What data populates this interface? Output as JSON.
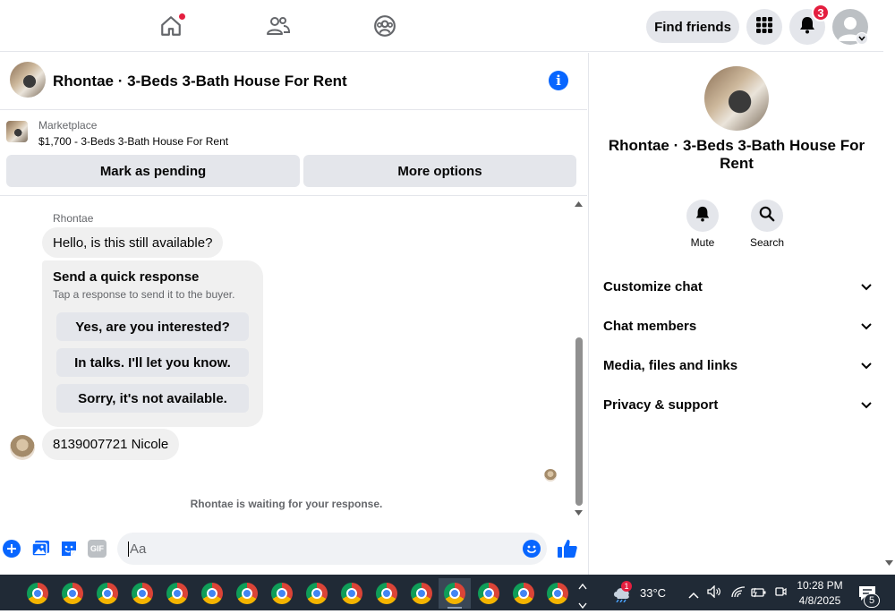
{
  "topnav": {
    "find_friends_label": "Find friends",
    "notification_count": "3"
  },
  "chat": {
    "title": "Rhontae · 3-Beds 3-Bath House For Rent",
    "marketplace_label": "Marketplace",
    "listing": "$1,700 - 3-Beds 3-Bath House For Rent",
    "mark_pending_label": "Mark as pending",
    "more_options_label": "More options",
    "sender_name": "Rhontae",
    "message_1": "Hello, is this still available?",
    "quick_response": {
      "title": "Send a quick response",
      "subtitle": "Tap a response to send it to the buyer.",
      "options": [
        "Yes, are you interested?",
        "In talks. I'll let you know.",
        "Sorry, it's not available."
      ]
    },
    "message_2": "8139007721 Nicole",
    "waiting_text": "Rhontae is waiting for your response.",
    "composer_placeholder": "Aa"
  },
  "right_panel": {
    "title": "Rhontae · 3-Beds 3-Bath House For Rent",
    "mute_label": "Mute",
    "search_label": "Search",
    "sections": [
      "Customize chat",
      "Chat members",
      "Media, files and links",
      "Privacy & support"
    ]
  },
  "taskbar": {
    "temperature": "33°C",
    "weather_badge": "1",
    "time": "10:28 PM",
    "date": "4/8/2025",
    "notification_count": "5"
  },
  "colors": {
    "accent": "#0866ff",
    "badge": "#e41e3f",
    "button_bg": "#e4e6eb",
    "taskbar_bg": "#202a36"
  }
}
